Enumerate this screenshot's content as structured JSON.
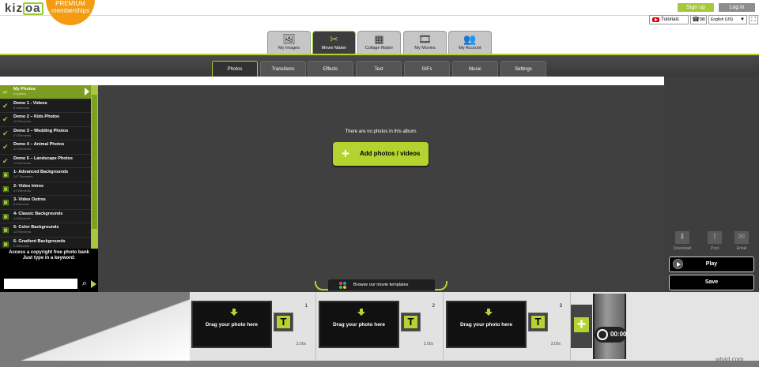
{
  "header": {
    "logo_text": "kiz",
    "logo_box": "oa",
    "premium_line1": "PREMIUM",
    "premium_line2": "memberships",
    "signup": "Sign up",
    "login": "Log in",
    "tutorials": "Tutorials",
    "language": "English (US)"
  },
  "main_tabs": [
    {
      "label": "My Images",
      "icon": "image-icon",
      "glyph": "🖼"
    },
    {
      "label": "Movie Maker",
      "icon": "film-scissors-icon",
      "glyph": "✂"
    },
    {
      "label": "Collage Maker",
      "icon": "collage-icon",
      "glyph": "▦"
    },
    {
      "label": "My Movies",
      "icon": "filmstrip-icon",
      "glyph": "🎞"
    },
    {
      "label": "My Account",
      "icon": "users-icon",
      "glyph": "👥"
    }
  ],
  "sub_tabs": [
    "Photos",
    "Transitions",
    "Effects",
    "Text",
    "GIFs",
    "Music",
    "Settings"
  ],
  "sidebar": {
    "items": [
      {
        "title": "My Photos",
        "sub": "(0 photo)"
      },
      {
        "title": "Demo 1 - Videos",
        "sub": "8 Elements"
      },
      {
        "title": "Demo 2 – Kids Photos",
        "sub": "10 Elements"
      },
      {
        "title": "Demo 3 – Wedding Photos",
        "sub": "27 Elements"
      },
      {
        "title": "Demo 4 – Animal Photos",
        "sub": "22 Elements"
      },
      {
        "title": "Demo 5 – Landscape Photos",
        "sub": "14 Elements"
      },
      {
        "title": "1- Advanced Backgrounds",
        "sub": "247 Elements"
      },
      {
        "title": "2- Video Intros",
        "sub": "47 Elements"
      },
      {
        "title": "3- Video Outros",
        "sub": "6 Elements"
      },
      {
        "title": "4- Classic Backgrounds",
        "sub": "14 Elements"
      },
      {
        "title": "5- Color Backgrounds",
        "sub": "12 Elements"
      },
      {
        "title": "6- Gradient Backgrounds",
        "sub": "9 Elements"
      }
    ],
    "keyword_line1": "Access a copyright free photo bank",
    "keyword_line2": "Just type in a keyword:"
  },
  "main": {
    "empty_message": "There are no photos in this album.",
    "add_button": "Add photos / videos"
  },
  "right_panel": {
    "download": "Download",
    "post": "Post",
    "email": "Email",
    "play": "Play",
    "save": "Save"
  },
  "templates_bar": "Browse our movie templates",
  "timeline": {
    "slots": [
      {
        "label": "Drag your photo here",
        "num": "1",
        "duration": "3.00s"
      },
      {
        "label": "Drag your photo here",
        "num": "2",
        "duration": "3.00s"
      },
      {
        "label": "Drag your photo here",
        "num": "3",
        "duration": "3.00s"
      }
    ],
    "text_glyph": "T",
    "total_time": "00:00"
  },
  "watermark": "wtvid.com",
  "colors": {
    "accent": "#b5d330",
    "premium": "#f39c12",
    "sidebar_selected": "#7c9c22"
  }
}
